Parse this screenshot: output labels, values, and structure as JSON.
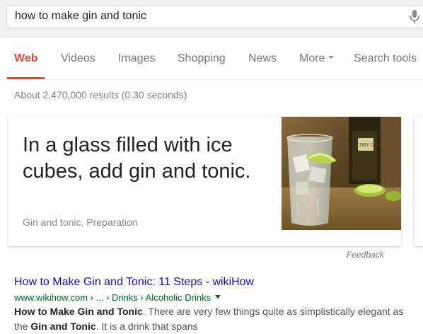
{
  "search": {
    "query": "how to make gin and tonic"
  },
  "tabs": [
    {
      "label": "Web",
      "active": true
    },
    {
      "label": "Videos"
    },
    {
      "label": "Images"
    },
    {
      "label": "Shopping"
    },
    {
      "label": "News"
    },
    {
      "label": "More"
    },
    {
      "label": "Search tools"
    }
  ],
  "stats": "About 2,470,000 results (0.30 seconds)",
  "answer_card": {
    "text": "In a glass filled with ice cubes, add gin and tonic.",
    "source": "Gin and tonic, Preparation",
    "image_icon": "gin-and-tonic-photo",
    "bottle_label": "DRY GIN"
  },
  "feedback_label": "Feedback",
  "result": {
    "title": "How to Make Gin and Tonic: 11 Steps - wikiHow",
    "url": "www.wikihow.com › ... › Drinks › Alcoholic Drinks",
    "snippet_bold1": "How to Make Gin and Tonic",
    "snippet_text1": ". There are very few things quite as simplistically elegant as the ",
    "snippet_bold2": "Gin and Tonic",
    "snippet_text2": ". It is a drink that spans"
  },
  "colors": {
    "accent": "#dd4b39",
    "link": "#1a0dab",
    "url": "#006621"
  }
}
